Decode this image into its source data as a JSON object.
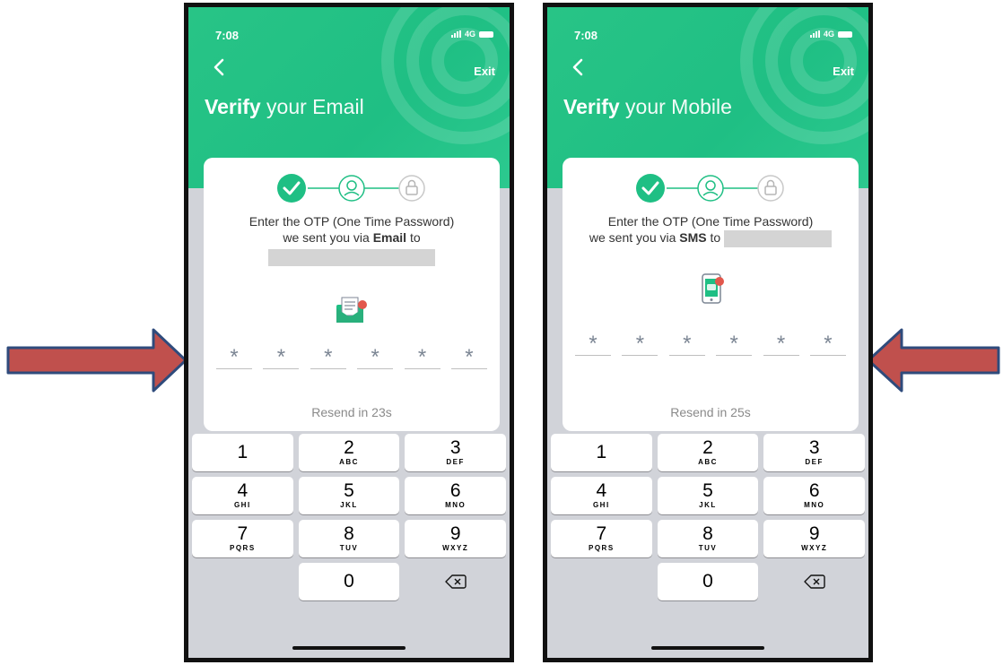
{
  "phones": [
    {
      "status_time": "7:08",
      "network": "4G",
      "exit_label": "Exit",
      "title_bold": "Verify",
      "title_rest": " your Email",
      "instruction_line1": "Enter the OTP (One Time Password)",
      "instruction_line2_prefix": "we sent you via ",
      "instruction_channel": "Email",
      "instruction_line2_suffix": " to",
      "otp_placeholder": "*",
      "resend_text": "Resend in 23s",
      "otp_icon": "email-envelope-icon"
    },
    {
      "status_time": "7:08",
      "network": "4G",
      "exit_label": "Exit",
      "title_bold": "Verify",
      "title_rest": " your Mobile",
      "instruction_line1": "Enter the OTP (One Time Password)",
      "instruction_line2_prefix": "we sent you via ",
      "instruction_channel": "SMS",
      "instruction_line2_suffix": " to",
      "otp_placeholder": "*",
      "resend_text": "Resend in 25s",
      "otp_icon": "sms-phone-icon"
    }
  ],
  "keypad": [
    {
      "num": "1",
      "letters": ""
    },
    {
      "num": "2",
      "letters": "ABC"
    },
    {
      "num": "3",
      "letters": "DEF"
    },
    {
      "num": "4",
      "letters": "GHI"
    },
    {
      "num": "5",
      "letters": "JKL"
    },
    {
      "num": "6",
      "letters": "MNO"
    },
    {
      "num": "7",
      "letters": "PQRS"
    },
    {
      "num": "8",
      "letters": "TUV"
    },
    {
      "num": "9",
      "letters": "WXYZ"
    },
    {
      "num": "0",
      "letters": ""
    }
  ],
  "colors": {
    "brand_green": "#1fbf84",
    "arrow_fill": "#c0504d",
    "arrow_border": "#2f4b7c",
    "keypad_bg": "#d1d3d9"
  }
}
